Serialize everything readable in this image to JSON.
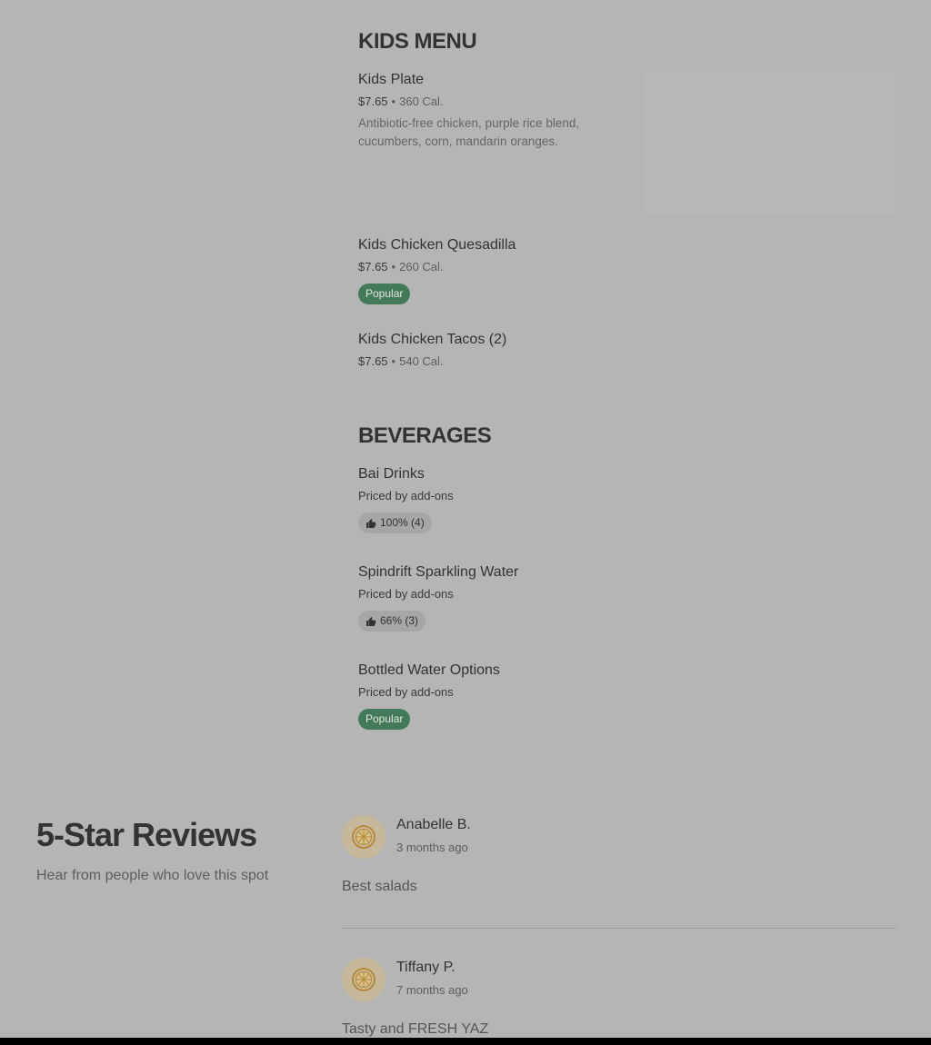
{
  "kids_menu": {
    "title": "KIDS MENU",
    "items": [
      {
        "name": "Kids Plate",
        "price": "$7.65",
        "calories": "360 Cal.",
        "description": "Antibiotic-free chicken, purple rice blend, cucumbers, corn, mandarin oranges."
      },
      {
        "name": "Kids Chicken Quesadilla",
        "price": "$7.65",
        "calories": "260 Cal.",
        "badge": "Popular"
      },
      {
        "name": "Kids Chicken Tacos (2)",
        "price": "$7.65",
        "calories": "540 Cal."
      }
    ]
  },
  "beverages": {
    "title": "BEVERAGES",
    "items": [
      {
        "name": "Bai Drinks",
        "price_text": "Priced by add-ons",
        "rating": "100% (4)"
      },
      {
        "name": "Spindrift Sparkling Water",
        "price_text": "Priced by add-ons",
        "rating": "66% (3)"
      },
      {
        "name": "Bottled Water Options",
        "price_text": "Priced by add-ons",
        "badge": "Popular"
      }
    ]
  },
  "reviews": {
    "title": "5-Star Reviews",
    "subtitle": "Hear from people who love this spot",
    "items": [
      {
        "name": "Anabelle B.",
        "time": "3 months ago",
        "text": "Best salads"
      },
      {
        "name": "Tiffany P.",
        "time": "7 months ago",
        "text": "Tasty and FRESH YAZ"
      }
    ]
  },
  "colors": {
    "overlay_bg": "#b5b5b5",
    "popular_badge": "#437a5a",
    "avatar_bg": "#c6b89b"
  },
  "icons": {
    "rating": "thumbs-up-icon",
    "avatar": "lemon-slice-icon"
  }
}
